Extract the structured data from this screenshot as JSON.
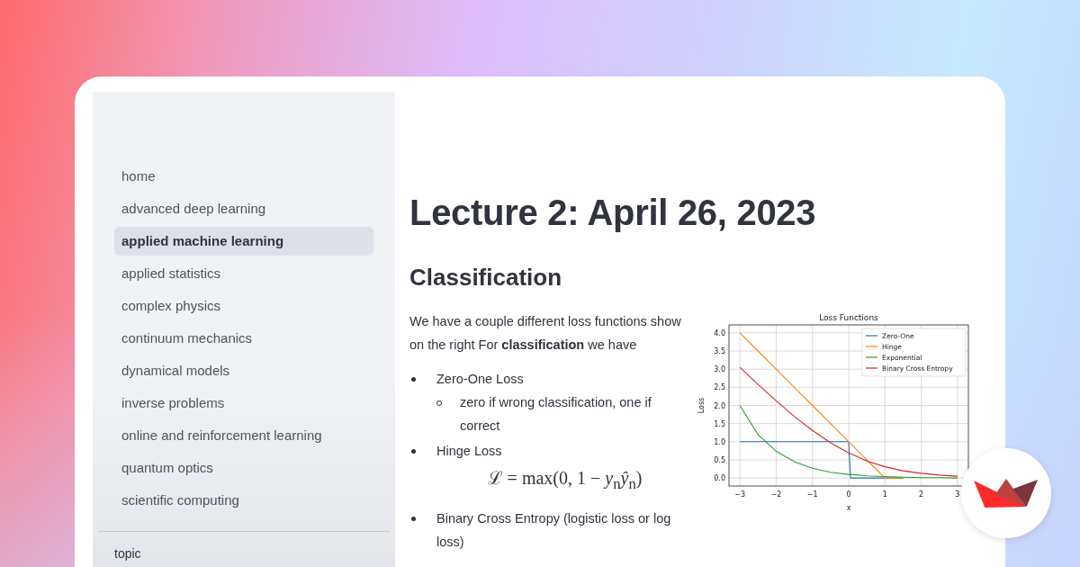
{
  "sidebar": {
    "items": [
      {
        "label": "home",
        "selected": false
      },
      {
        "label": "advanced deep learning",
        "selected": false
      },
      {
        "label": "applied machine learning",
        "selected": true
      },
      {
        "label": "applied statistics",
        "selected": false
      },
      {
        "label": "complex physics",
        "selected": false
      },
      {
        "label": "continuum mechanics",
        "selected": false
      },
      {
        "label": "dynamical models",
        "selected": false
      },
      {
        "label": "inverse problems",
        "selected": false
      },
      {
        "label": "online and reinforcement learning",
        "selected": false
      },
      {
        "label": "quantum optics",
        "selected": false
      },
      {
        "label": "scientific computing",
        "selected": false
      }
    ],
    "section_label": "topic"
  },
  "main": {
    "title": "Lecture 2: April 26, 2023",
    "heading": "Classification",
    "paragraph": "We have a couple different loss functions show on the right For **classification** we have",
    "bullets": [
      {
        "text": "Zero-One Loss",
        "children": [
          {
            "text": "zero if wrong classification, one if correct"
          }
        ]
      },
      {
        "text": "Hinge Loss",
        "formula": "ℒ = max(0, 1 − *y*$_{n}$*ŷ*$_{n}$)"
      },
      {
        "text": "Binary Cross Entropy (logistic loss or log loss)"
      }
    ],
    "chart_data": {
      "type": "line",
      "title": "Loss Functions",
      "xlabel": "x",
      "ylabel": "Loss",
      "x": [
        -3,
        -2.5,
        -2,
        -1.5,
        -1,
        -0.5,
        0,
        0.05,
        0.5,
        1,
        1.5,
        2,
        2.5,
        3
      ],
      "series": [
        {
          "name": "Zero-One",
          "color": "#1f77b4",
          "values": [
            1,
            1,
            1,
            1,
            1,
            1,
            1,
            0,
            0,
            0,
            0,
            null,
            null,
            null
          ]
        },
        {
          "name": "Hinge",
          "color": "#ff7f0e",
          "values": [
            4,
            3.5,
            3,
            2.5,
            2,
            1.5,
            1,
            0.95,
            0.5,
            0,
            0,
            null,
            null,
            null
          ]
        },
        {
          "name": "Exponential",
          "color": "#2ca02c",
          "values": [
            2.0,
            1.2,
            0.74,
            0.45,
            0.27,
            0.16,
            0.1,
            0.1,
            0.06,
            0.04,
            0.02,
            0.01,
            0.01,
            0.0
          ]
        },
        {
          "name": "Binary Cross Entropy",
          "color": "#d62728",
          "values": [
            3.05,
            2.58,
            2.13,
            1.7,
            1.31,
            0.97,
            0.69,
            0.67,
            0.47,
            0.31,
            0.2,
            0.13,
            0.08,
            0.05
          ]
        }
      ],
      "grid": true,
      "legend": true,
      "xlim": [
        -3.3,
        3.3
      ],
      "ylim": [
        -0.22,
        4.22
      ],
      "xticks": [
        {
          "value": -3,
          "label": "−3"
        },
        {
          "value": -2,
          "label": "−2"
        },
        {
          "value": -1,
          "label": "−1"
        },
        {
          "value": 0,
          "label": "0"
        },
        {
          "value": 1,
          "label": "1"
        },
        {
          "value": 2,
          "label": "2"
        },
        {
          "value": 3,
          "label": "3"
        }
      ],
      "yticks": [
        {
          "value": 0,
          "label": "0.0"
        },
        {
          "value": 0.5,
          "label": "0.5"
        },
        {
          "value": 1,
          "label": "1.0"
        },
        {
          "value": 1.5,
          "label": "1.5"
        },
        {
          "value": 2,
          "label": "2.0"
        },
        {
          "value": 2.5,
          "label": "2.5"
        },
        {
          "value": 3,
          "label": "3.0"
        },
        {
          "value": 3.5,
          "label": "3.5"
        },
        {
          "value": 4,
          "label": "4.0"
        }
      ]
    }
  }
}
